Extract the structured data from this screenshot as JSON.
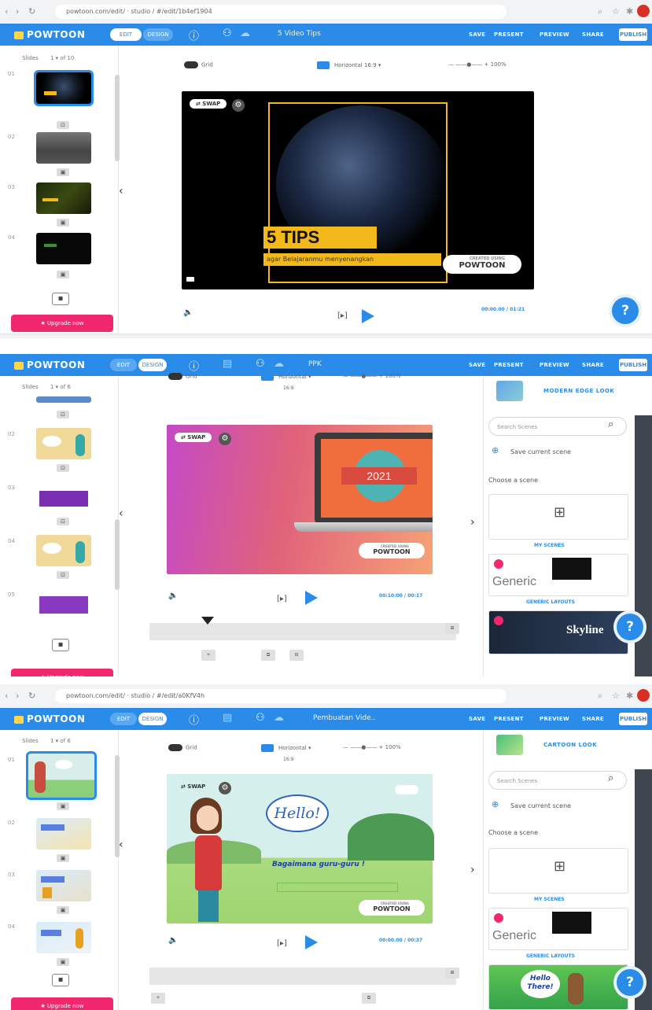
{
  "panel1": {
    "url": "powtoon.com/edit/ · studio / #/edit/1b4ef1904",
    "app_title": "5 Video Tips",
    "slides_label": "Slides",
    "slides_count": "1 ▾  of 10",
    "grid_label": "Grid",
    "orientation": "Horizontal 16:9",
    "zoom": "100%",
    "headline": "5 TIPS",
    "subtitle": "agar Belajaranmu menyenangkan",
    "time": "00:00.00 / 01:21"
  },
  "panel2": {
    "app_title": "PPK",
    "slides_count": "1 ▾  of 6",
    "grid_label": "Grid",
    "orientation": "Horizontal",
    "zoom": "100%",
    "ratio": "16:9",
    "year": "2021",
    "time": "00:10:00 / 00:17",
    "look_label": "MODERN EDGE LOOK",
    "search_placeholder": "Search Scenes",
    "save_scene": "Save current scene",
    "choose_scene": "Choose a scene",
    "my_scenes": "MY SCENES",
    "generic": "Generic",
    "generic_layouts": "GENERIC LAYOUTS",
    "skyline": "Skyline"
  },
  "panel3": {
    "url": "powtoon.com/edit/ · studio / #/edit/a0KfV4h",
    "app_title": "Pembuatan Vide..",
    "slides_count": "1 ▾  of 6",
    "grid_label": "Grid",
    "orientation": "Horizontal",
    "zoom": "100%",
    "ratio": "16:9",
    "hello": "Hello!",
    "greeting": "Bagaimana guru-guru !",
    "time": "00:00.00 / 00:37",
    "look_label": "CARTOON LOOK",
    "search_placeholder": "Search Scenes",
    "save_scene": "Save current scene",
    "choose_scene": "Choose a scene",
    "my_scenes": "MY SCENES",
    "generic": "Generic",
    "generic_layouts": "GENERIC LAYOUTS",
    "hello_there": "Hello There!"
  },
  "common": {
    "logo": "POWTOON",
    "edit_toggle": "EDIT",
    "design_toggle": "DESIGN",
    "menu": [
      "SAVE",
      "PRESENT",
      "PREVIEW",
      "SHARE"
    ],
    "publish": "PUBLISH",
    "swap": "⇄ SWAP",
    "upgrade": "★ Upgrade now",
    "help": "?",
    "powtoon_badge_top": "CREATED USING",
    "powtoon_badge": "POWTOON"
  },
  "colors": {
    "brand_blue": "#2a8ce8",
    "upgrade_pink": "#f2286f",
    "tips_yellow": "#f3b91b"
  }
}
